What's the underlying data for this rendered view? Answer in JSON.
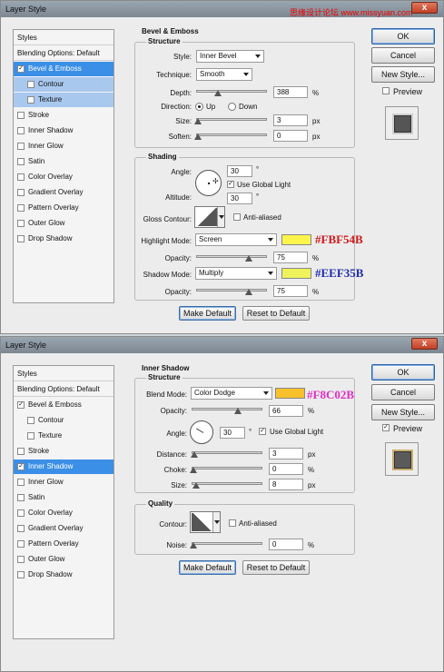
{
  "watermark": "思缘设计论坛 www.missyuan.com",
  "d1": {
    "title": "Layer Style",
    "close": "x",
    "styles_header": "Styles",
    "blending": "Blending Options: Default",
    "items": [
      {
        "label": "Bevel & Emboss",
        "checked": "✓"
      },
      {
        "label": "Contour",
        "checked": ""
      },
      {
        "label": "Texture",
        "checked": ""
      },
      {
        "label": "Stroke",
        "checked": ""
      },
      {
        "label": "Inner Shadow",
        "checked": ""
      },
      {
        "label": "Inner Glow",
        "checked": ""
      },
      {
        "label": "Satin",
        "checked": ""
      },
      {
        "label": "Color Overlay",
        "checked": ""
      },
      {
        "label": "Gradient Overlay",
        "checked": ""
      },
      {
        "label": "Pattern Overlay",
        "checked": ""
      },
      {
        "label": "Outer Glow",
        "checked": ""
      },
      {
        "label": "Drop Shadow",
        "checked": ""
      }
    ],
    "section": "Bevel & Emboss",
    "structure": "Structure",
    "style_label": "Style:",
    "style_value": "Inner Bevel",
    "technique_label": "Technique:",
    "technique_value": "Smooth",
    "depth_label": "Depth:",
    "depth_value": "388",
    "depth_unit": "%",
    "depth_level": 0.3,
    "direction_label": "Direction:",
    "dir_up": "Up",
    "dir_down": "Down",
    "size_label": "Size:",
    "size_value": "3",
    "size_unit": "px",
    "soften_label": "Soften:",
    "soften_value": "0",
    "soften_unit": "px",
    "shading": "Shading",
    "angle_label": "Angle:",
    "angle_value": "30",
    "angle_unit": "°",
    "global_light": "Use Global Light",
    "global_check": "✓",
    "altitude_label": "Altitude:",
    "altitude_value": "30",
    "altitude_unit": "°",
    "gloss_label": "Gloss Contour:",
    "anti_aliased": "Anti-aliased",
    "highlight_label": "Highlight Mode:",
    "highlight_value": "Screen",
    "highlight_color": "#FBF54B",
    "highlight_annot": "#FBF54B",
    "h_opacity_label": "Opacity:",
    "h_opacity_value": "75",
    "h_opacity_unit": "%",
    "shadow_label": "Shadow Mode:",
    "shadow_value": "Multiply",
    "shadow_color": "#EEF35B",
    "shadow_annot": "#EEF35B",
    "s_opacity_label": "Opacity:",
    "s_opacity_value": "75",
    "s_opacity_unit": "%",
    "make_default": "Make Default",
    "reset_default": "Reset to Default",
    "ok": "OK",
    "cancel": "Cancel",
    "new_style": "New Style...",
    "preview": "Preview"
  },
  "d2": {
    "title": "Layer Style",
    "close": "x",
    "styles_header": "Styles",
    "blending": "Blending Options: Default",
    "items": [
      {
        "label": "Bevel & Emboss",
        "checked": "✓"
      },
      {
        "label": "Contour",
        "checked": ""
      },
      {
        "label": "Texture",
        "checked": ""
      },
      {
        "label": "Stroke",
        "checked": ""
      },
      {
        "label": "Inner Shadow",
        "checked": "✓"
      },
      {
        "label": "Inner Glow",
        "checked": ""
      },
      {
        "label": "Satin",
        "checked": ""
      },
      {
        "label": "Color Overlay",
        "checked": ""
      },
      {
        "label": "Gradient Overlay",
        "checked": ""
      },
      {
        "label": "Pattern Overlay",
        "checked": ""
      },
      {
        "label": "Outer Glow",
        "checked": ""
      },
      {
        "label": "Drop Shadow",
        "checked": ""
      }
    ],
    "section": "Inner Shadow",
    "structure": "Structure",
    "blend_label": "Blend Mode:",
    "blend_value": "Color Dodge",
    "blend_color": "#F8C02B",
    "blend_annot": "#F8C02B",
    "opacity_label": "Opacity:",
    "opacity_value": "66",
    "opacity_unit": "%",
    "angle_label": "Angle:",
    "angle_value": "30",
    "angle_unit": "°",
    "global_light": "Use Global Light",
    "global_check": "✓",
    "distance_label": "Distance:",
    "distance_value": "3",
    "distance_unit": "px",
    "choke_label": "Choke:",
    "choke_value": "0",
    "choke_unit": "%",
    "size_label": "Size:",
    "size_value": "8",
    "size_unit": "px",
    "quality": "Quality",
    "contour_label": "Contour:",
    "anti_aliased": "Anti-aliased",
    "noise_label": "Noise:",
    "noise_value": "0",
    "noise_unit": "%",
    "make_default": "Make Default",
    "reset_default": "Reset to Default",
    "ok": "OK",
    "cancel": "Cancel",
    "new_style": "New Style...",
    "preview": "Preview",
    "preview_check": "✓"
  }
}
